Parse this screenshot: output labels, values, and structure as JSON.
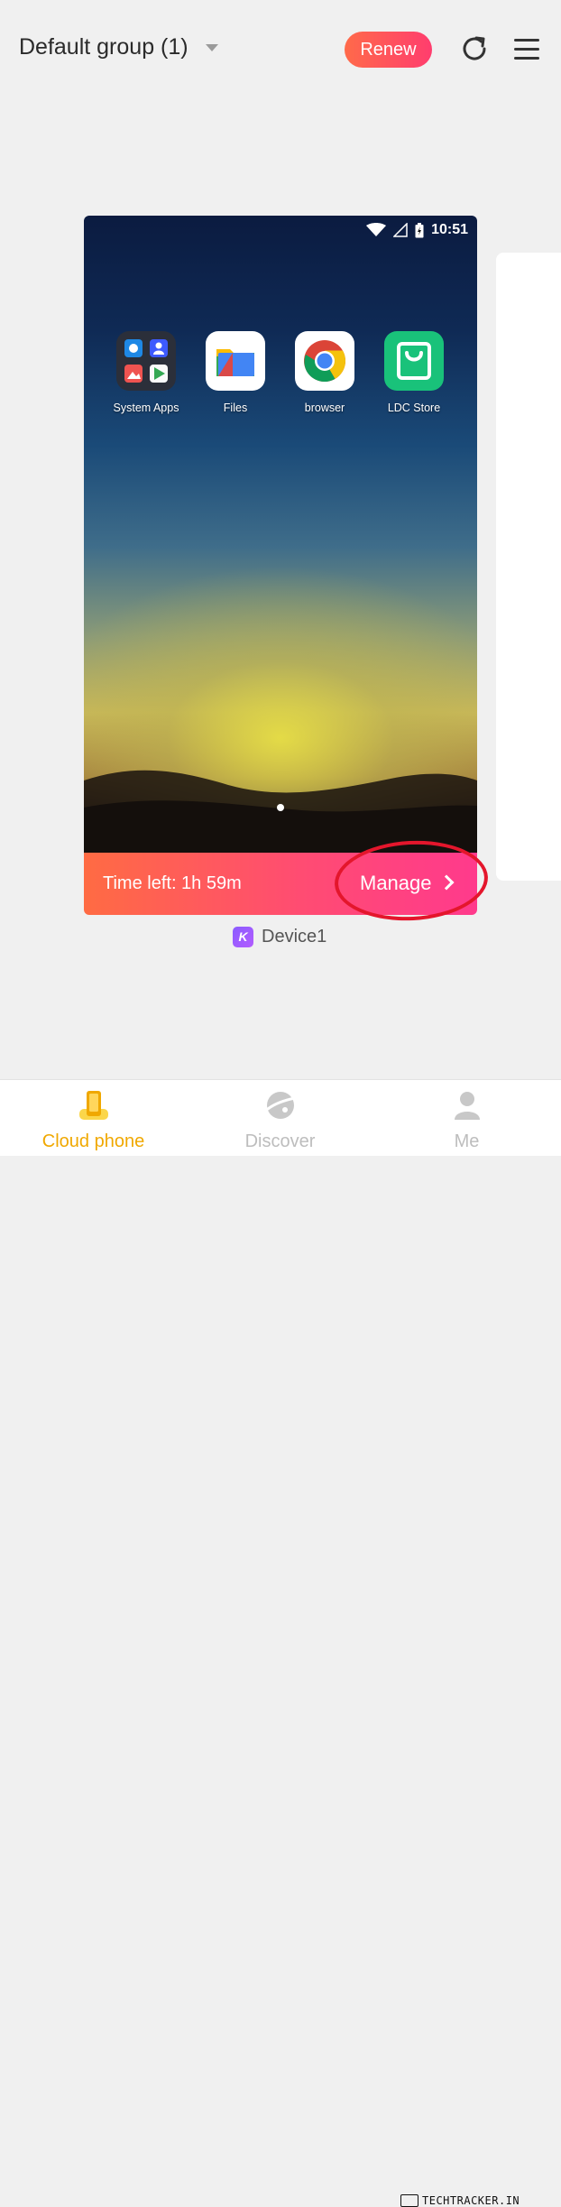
{
  "header": {
    "group_title": "Default group (1)",
    "renew_label": "Renew",
    "refresh_icon": "refresh-icon",
    "menu_icon": "hamburger-menu-icon"
  },
  "device_screen": {
    "status_time": "10:51",
    "apps": [
      {
        "label": "System Apps",
        "icon": "folder-icon"
      },
      {
        "label": "Files",
        "icon": "files-icon"
      },
      {
        "label": "browser",
        "icon": "chrome-icon"
      },
      {
        "label": "LDC Store",
        "icon": "store-bag-icon"
      }
    ]
  },
  "card": {
    "time_left": "Time left: 1h 59m",
    "manage_label": "Manage"
  },
  "device": {
    "badge": "K",
    "name": "Device1"
  },
  "nav": {
    "items": [
      {
        "label": "Cloud phone",
        "icon": "phone-icon",
        "active": true
      },
      {
        "label": "Discover",
        "icon": "planet-icon",
        "active": false
      },
      {
        "label": "Me",
        "icon": "user-icon",
        "active": false
      }
    ]
  },
  "watermark": "TECHTRACKER.IN",
  "colors": {
    "accent_orange": "#ff6b43",
    "accent_pink": "#ff3a8c",
    "nav_active": "#f0a800",
    "highlight_ring": "#e4162c"
  }
}
